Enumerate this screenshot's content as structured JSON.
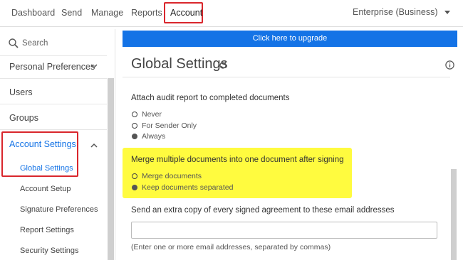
{
  "nav": {
    "items": [
      "Dashboard",
      "Send",
      "Manage",
      "Reports",
      "Account"
    ],
    "account_menu": "Enterprise (Business)"
  },
  "sidebar": {
    "search_placeholder": "Search",
    "personal_preferences": "Personal Preferences",
    "users": "Users",
    "groups": "Groups",
    "account_settings": "Account Settings",
    "sub_items": [
      "Global Settings",
      "Account Setup",
      "Signature Preferences",
      "Report Settings",
      "Security Settings"
    ]
  },
  "main": {
    "upgrade_banner": "Click here to upgrade",
    "title": "Global Settings",
    "audit": {
      "label": "Attach audit report to completed documents",
      "options": [
        "Never",
        "For Sender Only",
        "Always"
      ],
      "selected": "Always"
    },
    "merge": {
      "label": "Merge multiple documents into one document after signing",
      "options": [
        "Merge documents",
        "Keep documents separated"
      ],
      "selected": "Keep documents separated"
    },
    "email_copy": {
      "label": "Send an extra copy of every signed agreement to these email addresses",
      "value": "",
      "hint": "(Enter one or more email addresses, separated by commas)"
    }
  },
  "colors": {
    "accent": "#1473e6",
    "highlight_box": "#d9262c",
    "highlight_fill": "#fffb3f"
  }
}
